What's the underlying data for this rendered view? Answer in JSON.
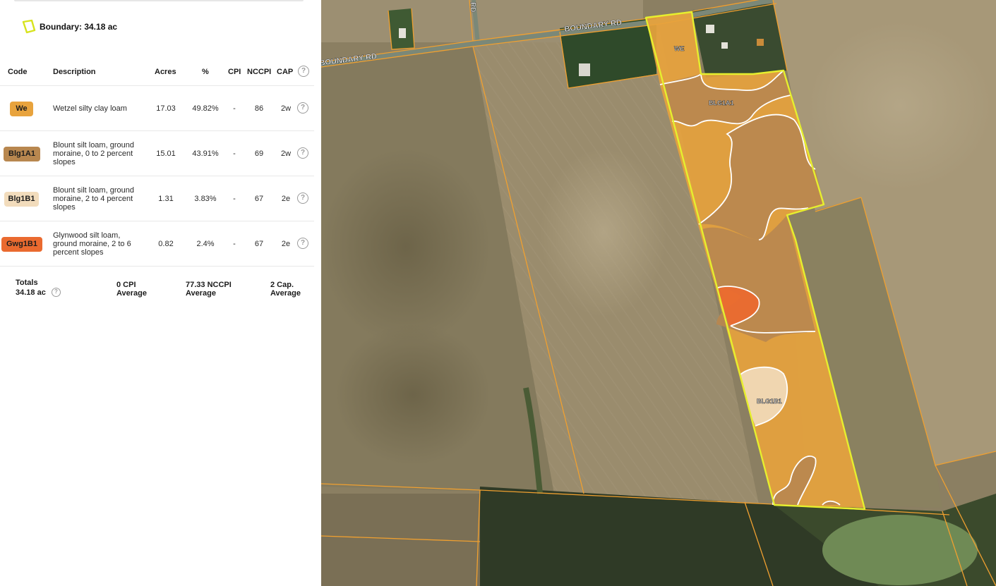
{
  "boundary": {
    "label": "Boundary: 34.18 ac",
    "icon": "boundary-polygon-icon"
  },
  "table": {
    "headers": {
      "code": "Code",
      "description": "Description",
      "acres": "Acres",
      "percent": "%",
      "cpi": "CPI",
      "nccpi": "NCCPI",
      "cap": "CAP",
      "help": "?"
    },
    "rows": [
      {
        "code": "We",
        "color": "#e8a33d",
        "description": [
          "Wetzel silty clay loam"
        ],
        "acres": "17.03",
        "percent": "49.82%",
        "cpi": "-",
        "nccpi": "86",
        "cap": "2w",
        "help": "?"
      },
      {
        "code": "Blg1A1",
        "color": "#b8874f",
        "description": [
          "Blount silt loam, ground",
          "moraine, 0 to 2 percent",
          "slopes"
        ],
        "acres": "15.01",
        "percent": "43.91%",
        "cpi": "-",
        "nccpi": "69",
        "cap": "2w",
        "help": "?"
      },
      {
        "code": "Blg1B1",
        "color": "#f2dcbc",
        "description": [
          "Blount silt loam, ground",
          "moraine, 2 to 4 percent",
          "slopes"
        ],
        "acres": "1.31",
        "percent": "3.83%",
        "cpi": "-",
        "nccpi": "67",
        "cap": "2e",
        "help": "?"
      },
      {
        "code": "Gwg1B1",
        "color": "#ea6a2f",
        "description": [
          "Glynwood silt loam,",
          "ground moraine, 2 to 6",
          "percent slopes"
        ],
        "acres": "0.82",
        "percent": "2.4%",
        "cpi": "-",
        "nccpi": "67",
        "cap": "2e",
        "help": "?"
      }
    ]
  },
  "totals": {
    "label": "Totals",
    "acres": "34.18 ac",
    "help": "?",
    "cpi_value": "0 CPI",
    "cpi_caption": "Average",
    "nccpi_value": "77.33 NCCPI",
    "nccpi_caption": "Average",
    "cap_value": "2 Cap.",
    "cap_caption": "Average"
  },
  "map": {
    "road_label_top": "BOUNDARY RD",
    "road_label_left": "BOUNDARY RD",
    "road_label_vertical": "RD",
    "zone_labels": {
      "we": "WE",
      "blg1a1": "BLG1A1",
      "blg1b1": "BLG1B1"
    },
    "colors": {
      "boundary": "#e6ef2e",
      "parcel_lines": "#f0a030",
      "zone_outline": "#ffffff"
    }
  }
}
